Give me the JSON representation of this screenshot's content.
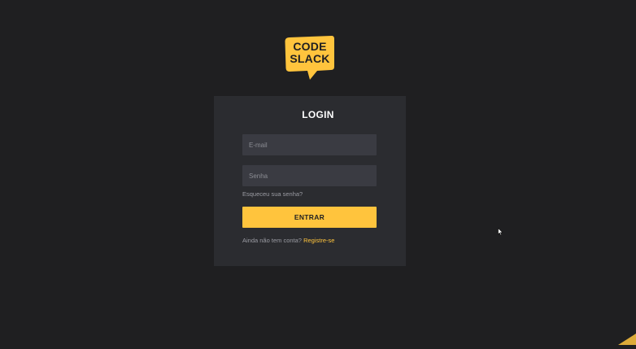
{
  "brand": {
    "line1": "CODE",
    "line2": "SLACK",
    "color": "#ffc43d"
  },
  "login": {
    "title": "LOGIN",
    "email_placeholder": "E-mail",
    "password_placeholder": "Senha",
    "forgot_password": "Esqueceu sua senha?",
    "submit_label": "ENTRAR",
    "no_account_text": "Ainda não tem conta?",
    "signup_link": "Registre-se"
  },
  "colors": {
    "background": "#1f1f21",
    "card": "#2b2c30",
    "input": "#3a3b42",
    "accent": "#ffc43d"
  }
}
